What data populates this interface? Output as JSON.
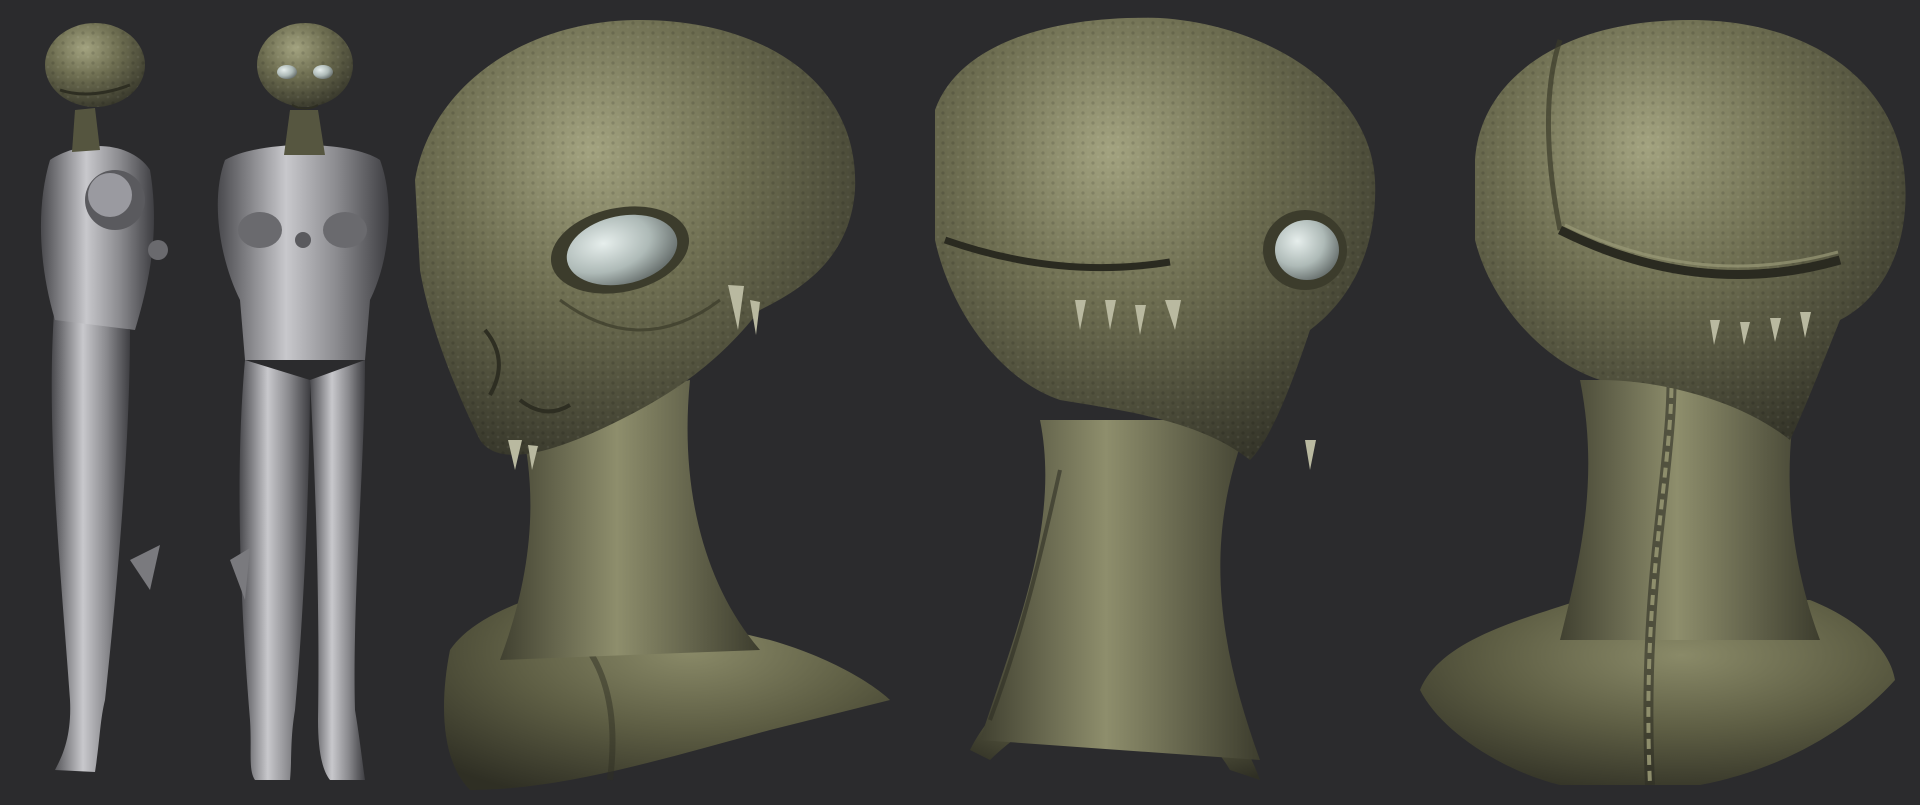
{
  "scene": {
    "background_color": "#2b2b2d",
    "views": [
      {
        "name": "full-body-side",
        "material": "gray-clay",
        "head_material": "olive-clay"
      },
      {
        "name": "full-body-front",
        "material": "gray-clay",
        "head_material": "olive-clay"
      },
      {
        "name": "head-three-quarter",
        "material": "olive-clay"
      },
      {
        "name": "head-side",
        "material": "olive-clay"
      },
      {
        "name": "head-back",
        "material": "olive-clay"
      }
    ],
    "colors": {
      "olive_clay": "#6b6b4e",
      "olive_shadow": "#3c3c2a",
      "olive_highlight": "#9a9a78",
      "gray_clay": "#8c8c90",
      "gray_shadow": "#4a4a4e",
      "gray_highlight": "#c4c4c8",
      "eye": "#c9d2cf"
    }
  }
}
